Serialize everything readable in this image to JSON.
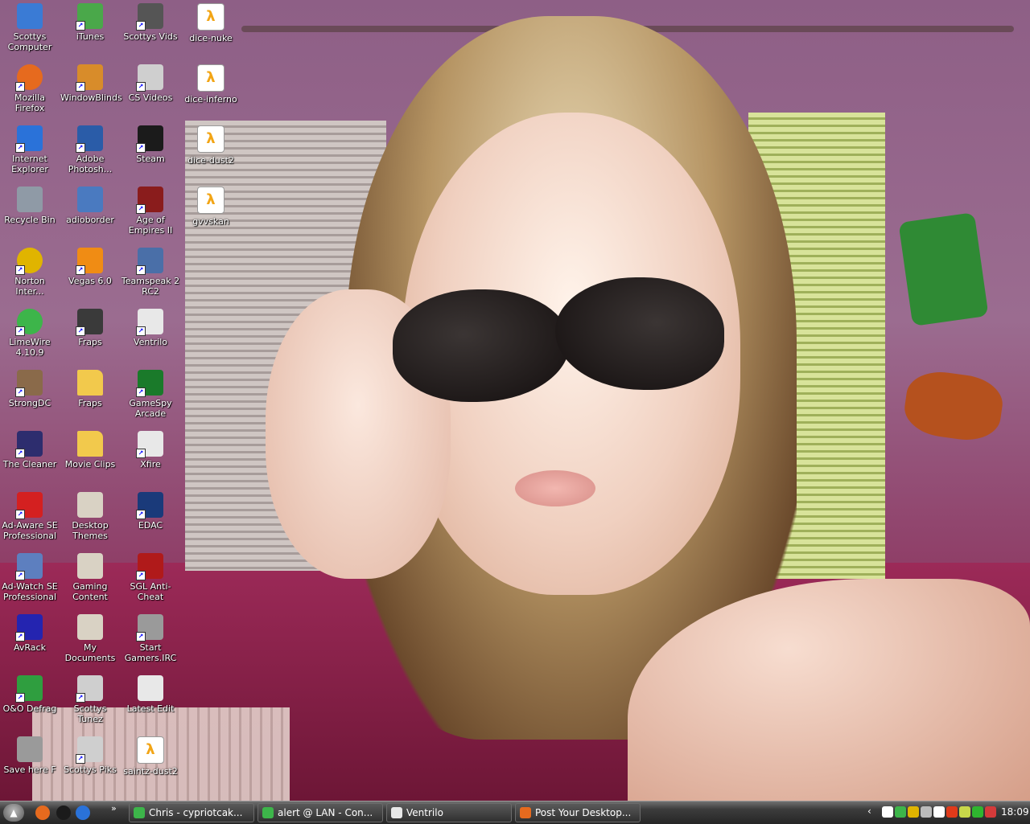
{
  "desktop": {
    "icons": [
      {
        "label": "Scottys Computer",
        "icon": "my-computer-icon",
        "color": "#3a7bd5"
      },
      {
        "label": "Mozilla Firefox",
        "icon": "firefox-icon",
        "color": "#e66a1e"
      },
      {
        "label": "Internet Explorer",
        "icon": "internet-explorer-icon",
        "color": "#2a72d9"
      },
      {
        "label": "Recycle Bin",
        "icon": "recycle-bin-icon",
        "color": "#8f9aa6"
      },
      {
        "label": "Norton Inter...",
        "icon": "norton-icon",
        "color": "#e0b400"
      },
      {
        "label": "LimeWire 4.10.9",
        "icon": "limewire-icon",
        "color": "#3db54a"
      },
      {
        "label": "StrongDC",
        "icon": "strongdc-icon",
        "color": "#8a6a4a"
      },
      {
        "label": "The Cleaner",
        "icon": "the-cleaner-icon",
        "color": "#2d2d6e"
      },
      {
        "label": "Ad-Aware SE Professional",
        "icon": "ad-aware-icon",
        "color": "#d42020"
      },
      {
        "label": "Ad-Watch SE Professional",
        "icon": "ad-watch-icon",
        "color": "#5d7fbf"
      },
      {
        "label": "AvRack",
        "icon": "avrack-icon",
        "color": "#2424b0"
      },
      {
        "label": "O&O Defrag",
        "icon": "defrag-icon",
        "color": "#2f9e3f"
      },
      {
        "label": "Save here F",
        "icon": "drive-icon",
        "color": "#9a9a9a"
      },
      {
        "label": "iTunes",
        "icon": "itunes-icon",
        "color": "#4aa84a"
      },
      {
        "label": "WindowBlinds",
        "icon": "windowblinds-icon",
        "color": "#d88c2a"
      },
      {
        "label": "Adobe Photosh...",
        "icon": "photoshop-icon",
        "color": "#2a5ca8"
      },
      {
        "label": "adioborder",
        "icon": "image-file-icon",
        "color": "#4a7ac0"
      },
      {
        "label": "Vegas 6.0",
        "icon": "vegas-icon",
        "color": "#f08c14"
      },
      {
        "label": "Fraps",
        "icon": "fraps-icon",
        "color": "#3a3a3a"
      },
      {
        "label": "Fraps",
        "icon": "folder-icon",
        "color": "#f2c94c"
      },
      {
        "label": "Movie Clips",
        "icon": "folder-icon",
        "color": "#f2c94c"
      },
      {
        "label": "Desktop Themes",
        "icon": "book-icon",
        "color": "#d9d2c4"
      },
      {
        "label": "Gaming Content",
        "icon": "book-icon",
        "color": "#d9d2c4"
      },
      {
        "label": "My Documents",
        "icon": "my-documents-icon",
        "color": "#d9d2c4"
      },
      {
        "label": "Scottys Tunez",
        "icon": "music-folder-icon",
        "color": "#cfcfcf"
      },
      {
        "label": "Scottys Piks",
        "icon": "pictures-folder-icon",
        "color": "#cfcfcf"
      },
      {
        "label": "Scottys Vids",
        "icon": "film-reel-icon",
        "color": "#555555"
      },
      {
        "label": "CS Videos",
        "icon": "cs-videos-icon",
        "color": "#cfcfcf"
      },
      {
        "label": "Steam",
        "icon": "steam-icon",
        "color": "#1b1b1b"
      },
      {
        "label": "Age of Empires II",
        "icon": "age-of-empires-icon",
        "color": "#8a1c1c"
      },
      {
        "label": "Teamspeak 2 RC2",
        "icon": "teamspeak-icon",
        "color": "#4a6fa8"
      },
      {
        "label": "Ventrilo",
        "icon": "ventrilo-icon",
        "color": "#e8e8e8"
      },
      {
        "label": "GameSpy Arcade",
        "icon": "gamespy-icon",
        "color": "#1a7a2a"
      },
      {
        "label": "Xfire",
        "icon": "xfire-icon",
        "color": "#e8e8e8"
      },
      {
        "label": "EDAC",
        "icon": "edac-icon",
        "color": "#1a3a7a"
      },
      {
        "label": "SGL Anti-Cheat",
        "icon": "sgl-icon",
        "color": "#b01a1a"
      },
      {
        "label": "Start Gamers.IRC",
        "icon": "irc-icon",
        "color": "#9a9a9a"
      },
      {
        "label": "Latest Edit",
        "icon": "config-file-icon",
        "color": "#e8e8e8"
      },
      {
        "label": "saintz-dust2",
        "icon": "half-life-file-icon",
        "color": "#f2a516"
      },
      {
        "label": "dice-nuke",
        "icon": "half-life-file-icon",
        "color": "#f2a516"
      },
      {
        "label": "dice-inferno",
        "icon": "half-life-file-icon",
        "color": "#f2a516"
      },
      {
        "label": "dice-dust2",
        "icon": "half-life-file-icon",
        "color": "#f2a516"
      },
      {
        "label": "gvvskan",
        "icon": "half-life-file-icon",
        "color": "#f2a516"
      }
    ]
  },
  "taskbar": {
    "start_icon": "start-orb-icon",
    "quick_launch": [
      {
        "icon": "firefox-icon",
        "color": "#e66a1e"
      },
      {
        "icon": "steam-icon",
        "color": "#1b1b1b"
      },
      {
        "icon": "internet-explorer-icon",
        "color": "#2a72d9"
      }
    ],
    "quick_launch_more": "»",
    "tasks": [
      {
        "label": "Chris - cypriotcak...",
        "icon": "msn-messenger-icon",
        "color": "#3db54a"
      },
      {
        "label": "alert @ LAN - Con...",
        "icon": "msn-messenger-icon",
        "color": "#3db54a"
      },
      {
        "label": "Ventrilo",
        "icon": "ventrilo-icon",
        "color": "#e8e8e8"
      },
      {
        "label": "Post Your Desktop...",
        "icon": "firefox-icon",
        "color": "#e66a1e"
      }
    ],
    "tray": {
      "expand": "‹",
      "icons": [
        {
          "icon": "steam-tray-icon",
          "color": "#ffffff"
        },
        {
          "icon": "msn-tray-icon",
          "color": "#3db54a"
        },
        {
          "icon": "norton-tray-icon",
          "color": "#e0b400"
        },
        {
          "icon": "ventrilo-tray-icon",
          "color": "#bbbbbb"
        },
        {
          "icon": "fraps-tray-icon",
          "color": "#ffffff"
        },
        {
          "icon": "security-alert-icon",
          "color": "#e03a1a"
        },
        {
          "icon": "network-tray-icon",
          "color": "#c8d84a"
        },
        {
          "icon": "battery-tray-icon",
          "color": "#2fb52f"
        },
        {
          "icon": "edac-tray-icon",
          "color": "#d43a3a"
        }
      ],
      "clock": "18:09"
    }
  }
}
